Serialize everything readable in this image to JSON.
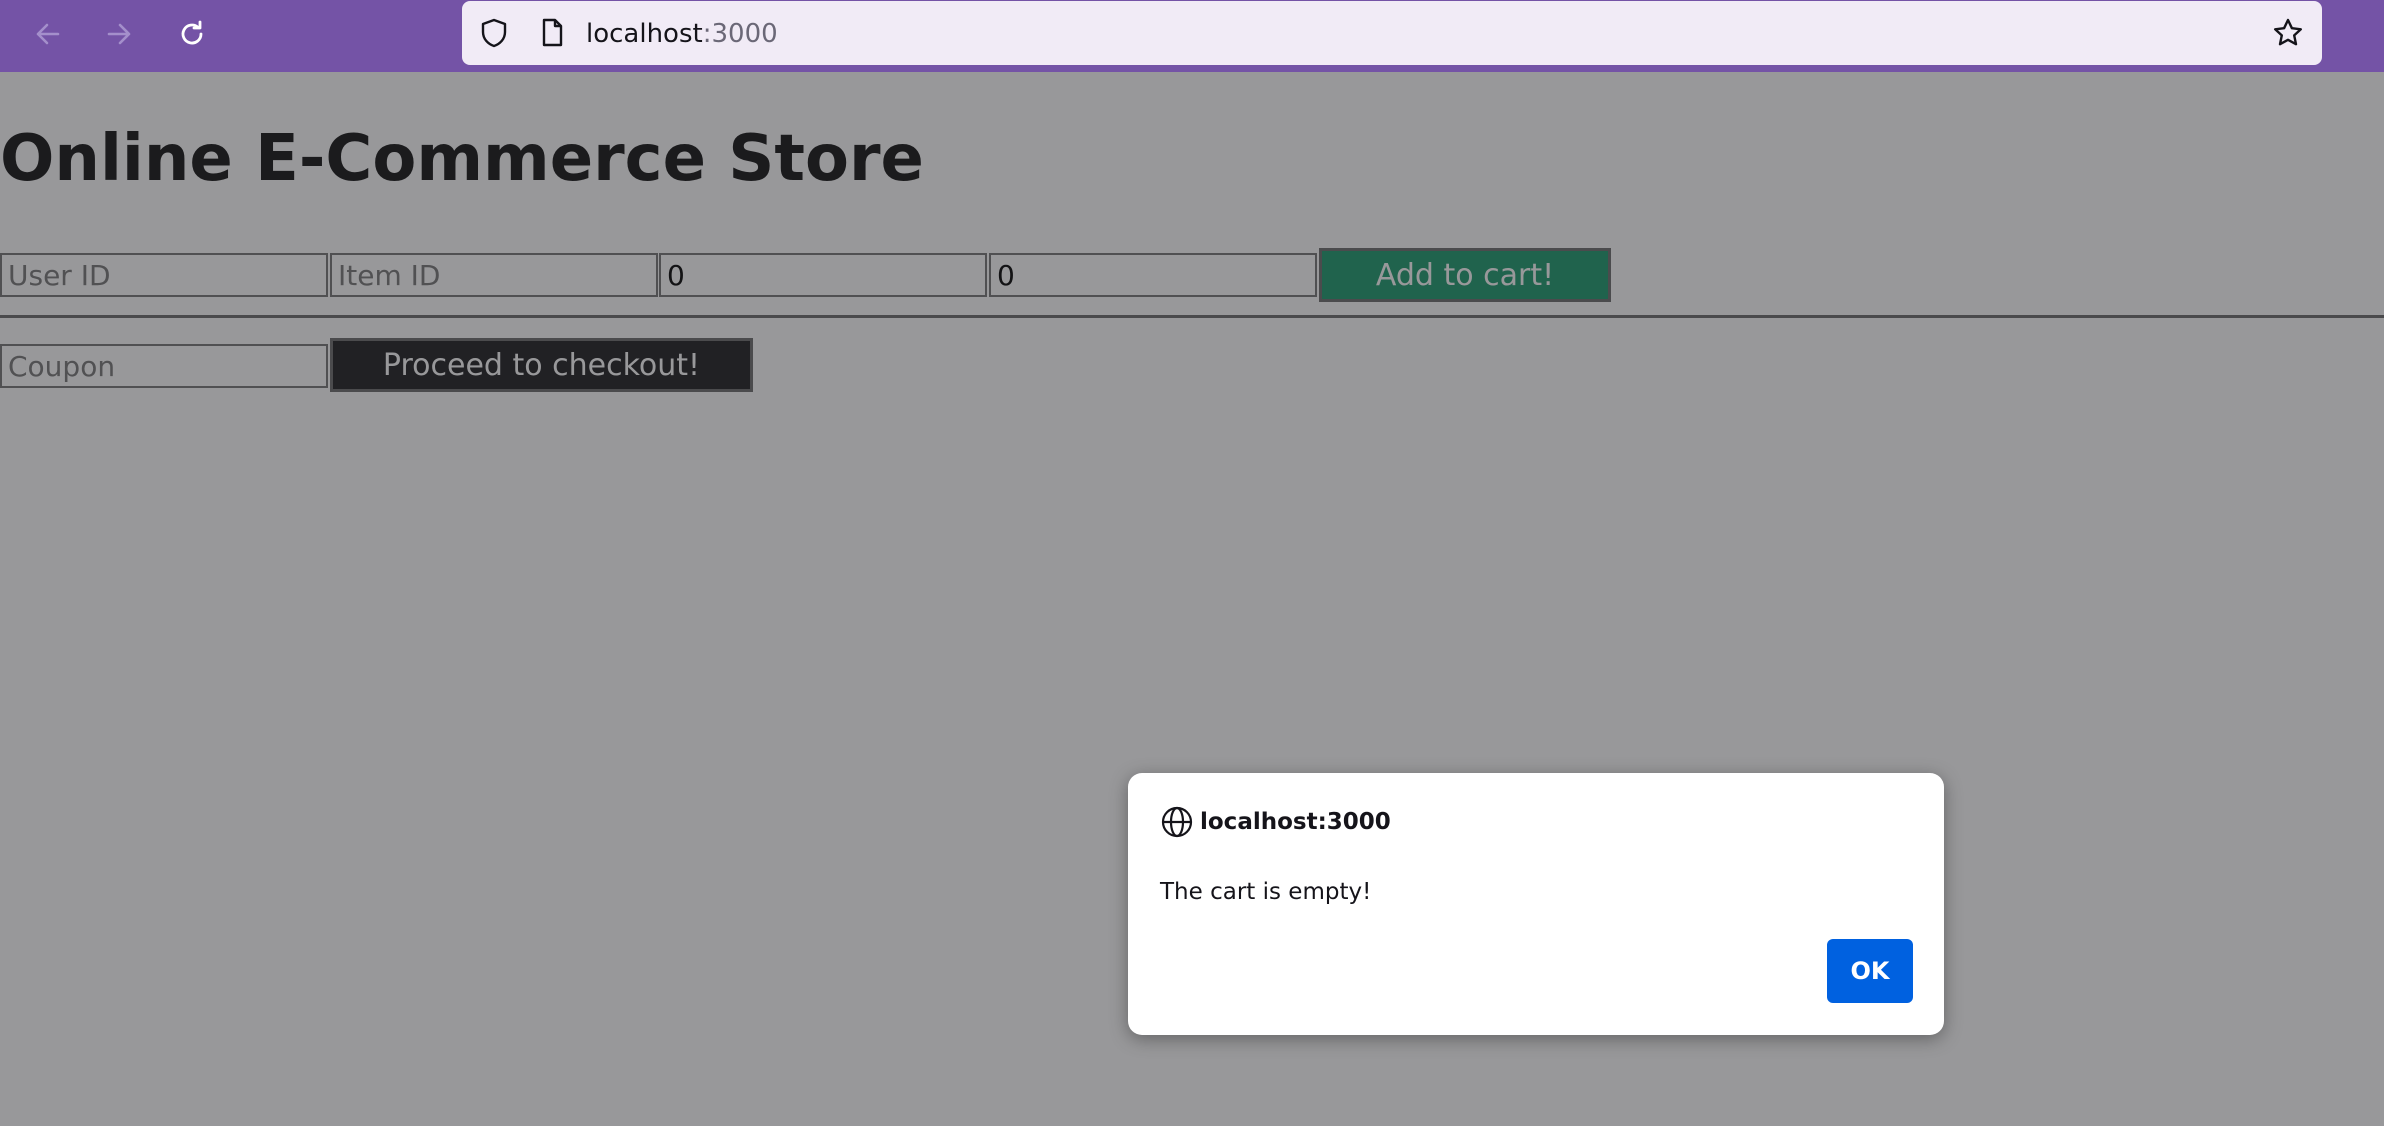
{
  "browser": {
    "url_host": "localhost",
    "url_port": ":3000",
    "toolbar_color": "#7453a6",
    "icons": [
      "back-arrow-icon",
      "forward-arrow-icon",
      "reload-icon",
      "shield-icon",
      "page-icon",
      "star-icon"
    ]
  },
  "page": {
    "title": "Online E-Commerce Store",
    "add_form": {
      "user_id_placeholder": "User ID",
      "item_id_placeholder": "Item ID",
      "field3_value": "0",
      "field4_value": "0",
      "add_button_label": "Add to cart!",
      "add_button_color": "#1a9a6b"
    },
    "checkout_form": {
      "coupon_placeholder": "Coupon",
      "checkout_button_label": "Proceed to checkout!",
      "checkout_button_color": "#1c1c1e"
    }
  },
  "dialog": {
    "origin": "localhost:3000",
    "message": "The cart is empty!",
    "ok_label": "OK",
    "ok_color": "#0061e0",
    "origin_icon": "globe-icon"
  }
}
